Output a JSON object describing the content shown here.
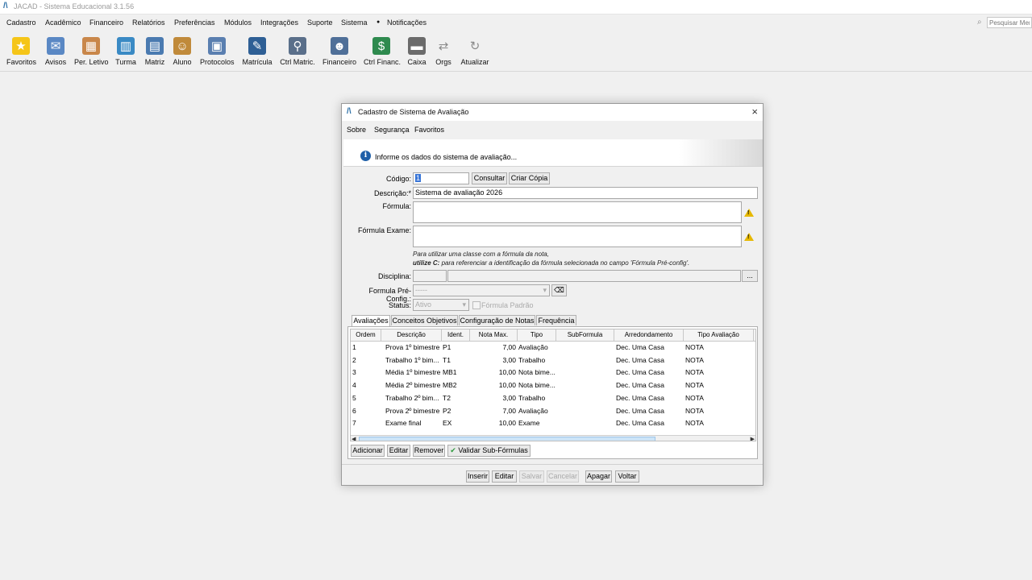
{
  "app": {
    "logo": "/\\",
    "title": "JACAD - Sistema Educacional 3.1.56"
  },
  "menu": [
    "Cadastro",
    "Acadêmico",
    "Financeiro",
    "Relatórios",
    "Preferências",
    "Módulos",
    "Integrações",
    "Suporte",
    "Sistema",
    "Notificações"
  ],
  "search": {
    "placeholder": "Pesquisar Men"
  },
  "toolbar": [
    {
      "label": "Favoritos",
      "icon": "star-icon",
      "color": "#f5c518",
      "glyph": "★"
    },
    {
      "label": "Avisos",
      "icon": "envelope-icon",
      "color": "#5a88c4",
      "glyph": "✉"
    },
    {
      "label": "Per. Letivo",
      "icon": "calendar-icon",
      "color": "#c9874a",
      "glyph": "▦"
    },
    {
      "label": "Turma",
      "icon": "group-icon",
      "color": "#3a8ac4",
      "glyph": "▥"
    },
    {
      "label": "Matriz",
      "icon": "matrix-icon",
      "color": "#4a7ab0",
      "glyph": "▤"
    },
    {
      "label": "Aluno",
      "icon": "student-icon",
      "color": "#c08a3a",
      "glyph": "☺"
    },
    {
      "label": "Protocolos",
      "icon": "protocol-icon",
      "color": "#5a7fb0",
      "glyph": "▣"
    },
    {
      "label": "Matrícula",
      "icon": "enrollment-icon",
      "color": "#2e5f95",
      "glyph": "✎"
    },
    {
      "label": "Ctrl Matric.",
      "icon": "control-enrollment-icon",
      "color": "#5a6f8a",
      "glyph": "⚲"
    },
    {
      "label": "Financeiro",
      "icon": "finance-user-icon",
      "color": "#4f6f98",
      "glyph": "☻"
    },
    {
      "label": "Ctrl Financ.",
      "icon": "money-icon",
      "color": "#2e8a4e",
      "glyph": "$"
    },
    {
      "label": "Caixa",
      "icon": "cash-register-icon",
      "color": "#6b6b6b",
      "glyph": "▬"
    },
    {
      "label": "Orgs",
      "icon": "swap-arrows-icon",
      "color": "#8a8a8a",
      "glyph": "⇄"
    },
    {
      "label": "Atualizar",
      "icon": "refresh-icon",
      "color": "#8a8a8a",
      "glyph": "↻"
    }
  ],
  "dialog": {
    "logo": "/\\",
    "title": "Cadastro de Sistema de Avaliação",
    "close": "×",
    "menu": [
      "Sobre",
      "Segurança",
      "Favoritos"
    ],
    "info_glyph": "i",
    "banner": "Informe os dados do sistema de avaliação...",
    "codigo_label": "Código:",
    "codigo_value": "1",
    "consultar": "Consultar",
    "criar_copia": "Criar Cópia",
    "descricao_label": "Descrição:*",
    "descricao_value": "Sistema de avaliação 2026",
    "formula_label": "Fórmula:",
    "formula_exame_label": "Fórmula Exame:",
    "warn_glyph": "!",
    "hint1": "Para utilizar uma classe com a fórmula da nota,",
    "hint2_bold": "utilize C:",
    "hint2_rest": " para referenciar a identificação da fórmula selecionada no campo 'Fórmula Pré-config'.",
    "disciplina_label": "Disciplina:",
    "disciplina_btn": "...",
    "preconfig_label": "Formula Pré-Config.:",
    "preconfig_value": "-----",
    "dropdown_glyph": "▾",
    "status_label": "Status:",
    "status_value": "Ativo",
    "formula_padrao": "Fórmula Padrão",
    "tabs": [
      "Avaliações",
      "Conceitos Objetivos",
      "Configuração de Notas",
      "Frequência"
    ],
    "columns": [
      "Ordem",
      "Descrição",
      "Ident.",
      "Nota Max.",
      "Tipo",
      "SubFormula",
      "Arredondamento",
      "Tipo Avaliação"
    ],
    "rows": [
      [
        "1",
        "Prova 1º bimestre",
        "P1",
        "7,00",
        "Avaliação",
        "",
        "Dec. Uma Casa",
        "NOTA"
      ],
      [
        "2",
        "Trabalho 1º bim...",
        "T1",
        "3,00",
        "Trabalho",
        "",
        "Dec. Uma Casa",
        "NOTA"
      ],
      [
        "3",
        "Média 1º bimestre",
        "MB1",
        "10,00",
        "Nota bime...",
        "",
        "Dec. Uma Casa",
        "NOTA"
      ],
      [
        "4",
        "Média 2º bimestre",
        "MB2",
        "10,00",
        "Nota bime...",
        "",
        "Dec. Uma Casa",
        "NOTA"
      ],
      [
        "5",
        "Trabalho 2º bim...",
        "T2",
        "3,00",
        "Trabalho",
        "",
        "Dec. Uma Casa",
        "NOTA"
      ],
      [
        "6",
        "Prova 2º bimestre",
        "P2",
        "7,00",
        "Avaliação",
        "",
        "Dec. Uma Casa",
        "NOTA"
      ],
      [
        "7",
        "Exame final",
        "EX",
        "10,00",
        "Exame",
        "",
        "Dec. Uma Casa",
        "NOTA"
      ]
    ],
    "scroll_left": "◀",
    "scroll_right": "▶",
    "panel_buttons": [
      "Adicionar",
      "Editar",
      "Remover",
      "Validar Sub-Fórmulas"
    ],
    "check_glyph": "✔",
    "footer_buttons": [
      "Inserir",
      "Editar",
      "Salvar",
      "Cancelar",
      "Apagar",
      "Voltar"
    ],
    "footer_disabled": [
      false,
      false,
      true,
      true,
      false,
      false
    ]
  }
}
